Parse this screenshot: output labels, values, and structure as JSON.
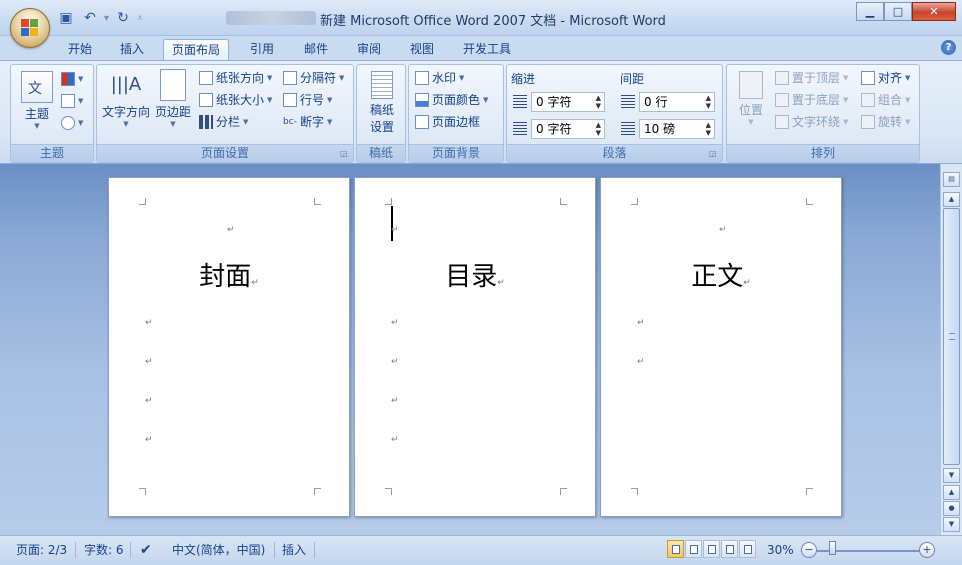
{
  "window": {
    "title": "新建 Microsoft Office Word 2007 文档 - Microsoft Word",
    "controls": {
      "minimize": "▁",
      "maximize": "□",
      "close": "✕"
    }
  },
  "quick_access": [
    "save-icon",
    "undo-icon",
    "redo-icon",
    "customize-icon"
  ],
  "tabs": [
    "开始",
    "插入",
    "页面布局",
    "引用",
    "邮件",
    "审阅",
    "视图",
    "开发工具"
  ],
  "active_tab": "页面布局",
  "help": "?",
  "ribbon": {
    "theme": {
      "label": "主题",
      "button": "主题"
    },
    "page_setup": {
      "label": "页面设置",
      "text_direction": "文字方向",
      "margins": "页边距",
      "orientation": "纸张方向",
      "size": "纸张大小",
      "columns": "分栏",
      "breaks": "分隔符",
      "line_numbers": "行号",
      "hyphenation": "断字"
    },
    "manuscript": {
      "label": "稿纸",
      "button_line1": "稿纸",
      "button_line2": "设置"
    },
    "page_background": {
      "label": "页面背景",
      "watermark": "水印",
      "page_color": "页面颜色",
      "page_borders": "页面边框"
    },
    "paragraph": {
      "label": "段落",
      "indent_title": "缩进",
      "spacing_title": "间距",
      "indent_left": "0 字符",
      "indent_right": "0 字符",
      "spacing_before": "0 行",
      "spacing_after": "10 磅"
    },
    "arrange": {
      "label": "排列",
      "position": "位置",
      "bring_front": "置于顶层",
      "send_back": "置于底层",
      "text_wrap": "文字环绕",
      "align": "对齐",
      "group": "组合",
      "rotate": "旋转"
    }
  },
  "pages": [
    {
      "heading": "封面",
      "blank_paragraphs": 4
    },
    {
      "heading": "目录",
      "blank_paragraphs": 4
    },
    {
      "heading": "正文",
      "blank_paragraphs": 2
    }
  ],
  "paragraph_mark": "↵",
  "status": {
    "page": "页面: 2/3",
    "words": "字数: 6",
    "language": "中文(简体，中国)",
    "mode": "插入",
    "zoom": "30%"
  },
  "zoom_level": 0.3
}
